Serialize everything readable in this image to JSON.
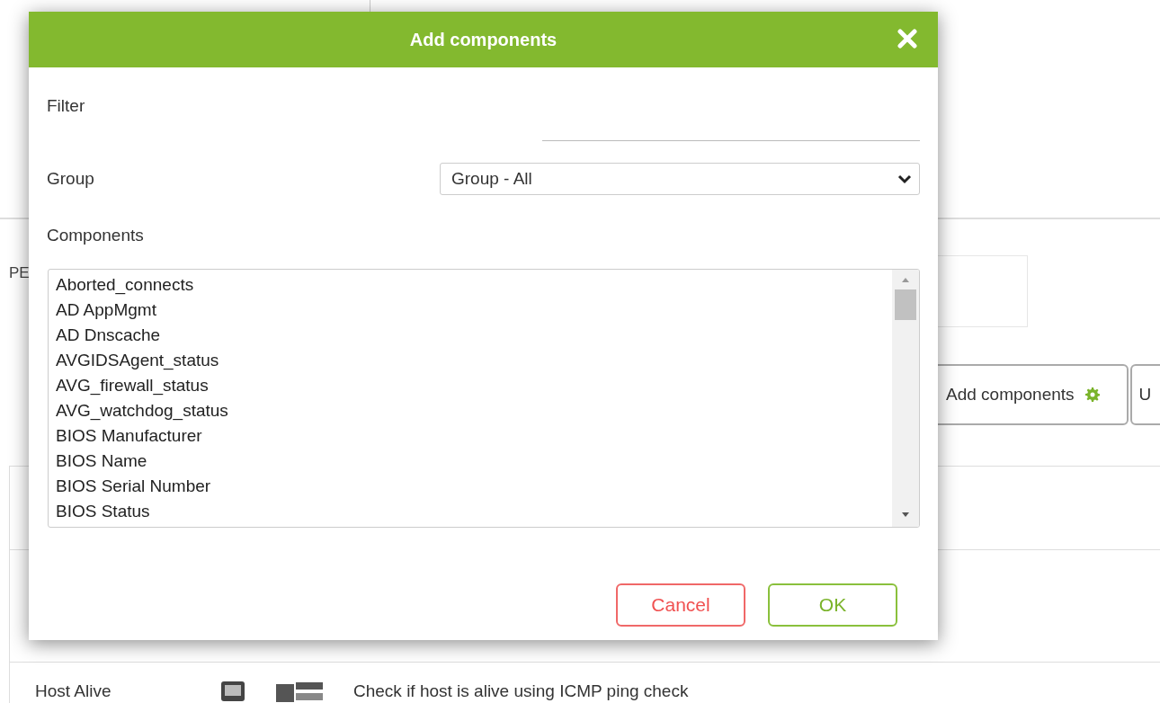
{
  "background": {
    "partial_label": "PE",
    "buttons": [
      {
        "label": "Add components",
        "has_icon": true
      },
      {
        "label": "U",
        "has_icon": false
      }
    ],
    "table": {
      "rows": [
        {
          "module_name": "Host Alive",
          "description": "Check if host is alive using ICMP ping check"
        }
      ]
    }
  },
  "dialog": {
    "title": "Add components",
    "filter": {
      "label": "Filter"
    },
    "group": {
      "label": "Group",
      "value": "Group - All"
    },
    "components": {
      "label": "Components",
      "items": [
        "Aborted_connects",
        "AD AppMgmt",
        "AD Dnscache",
        "AVGIDSAgent_status",
        "AVG_firewall_status",
        "AVG_watchdog_status",
        "BIOS Manufacturer",
        "BIOS Name",
        "BIOS Serial Number",
        "BIOS Status"
      ]
    },
    "buttons": [
      {
        "label": "Cancel",
        "kind": "cancel"
      },
      {
        "label": "OK",
        "kind": "ok"
      }
    ]
  }
}
